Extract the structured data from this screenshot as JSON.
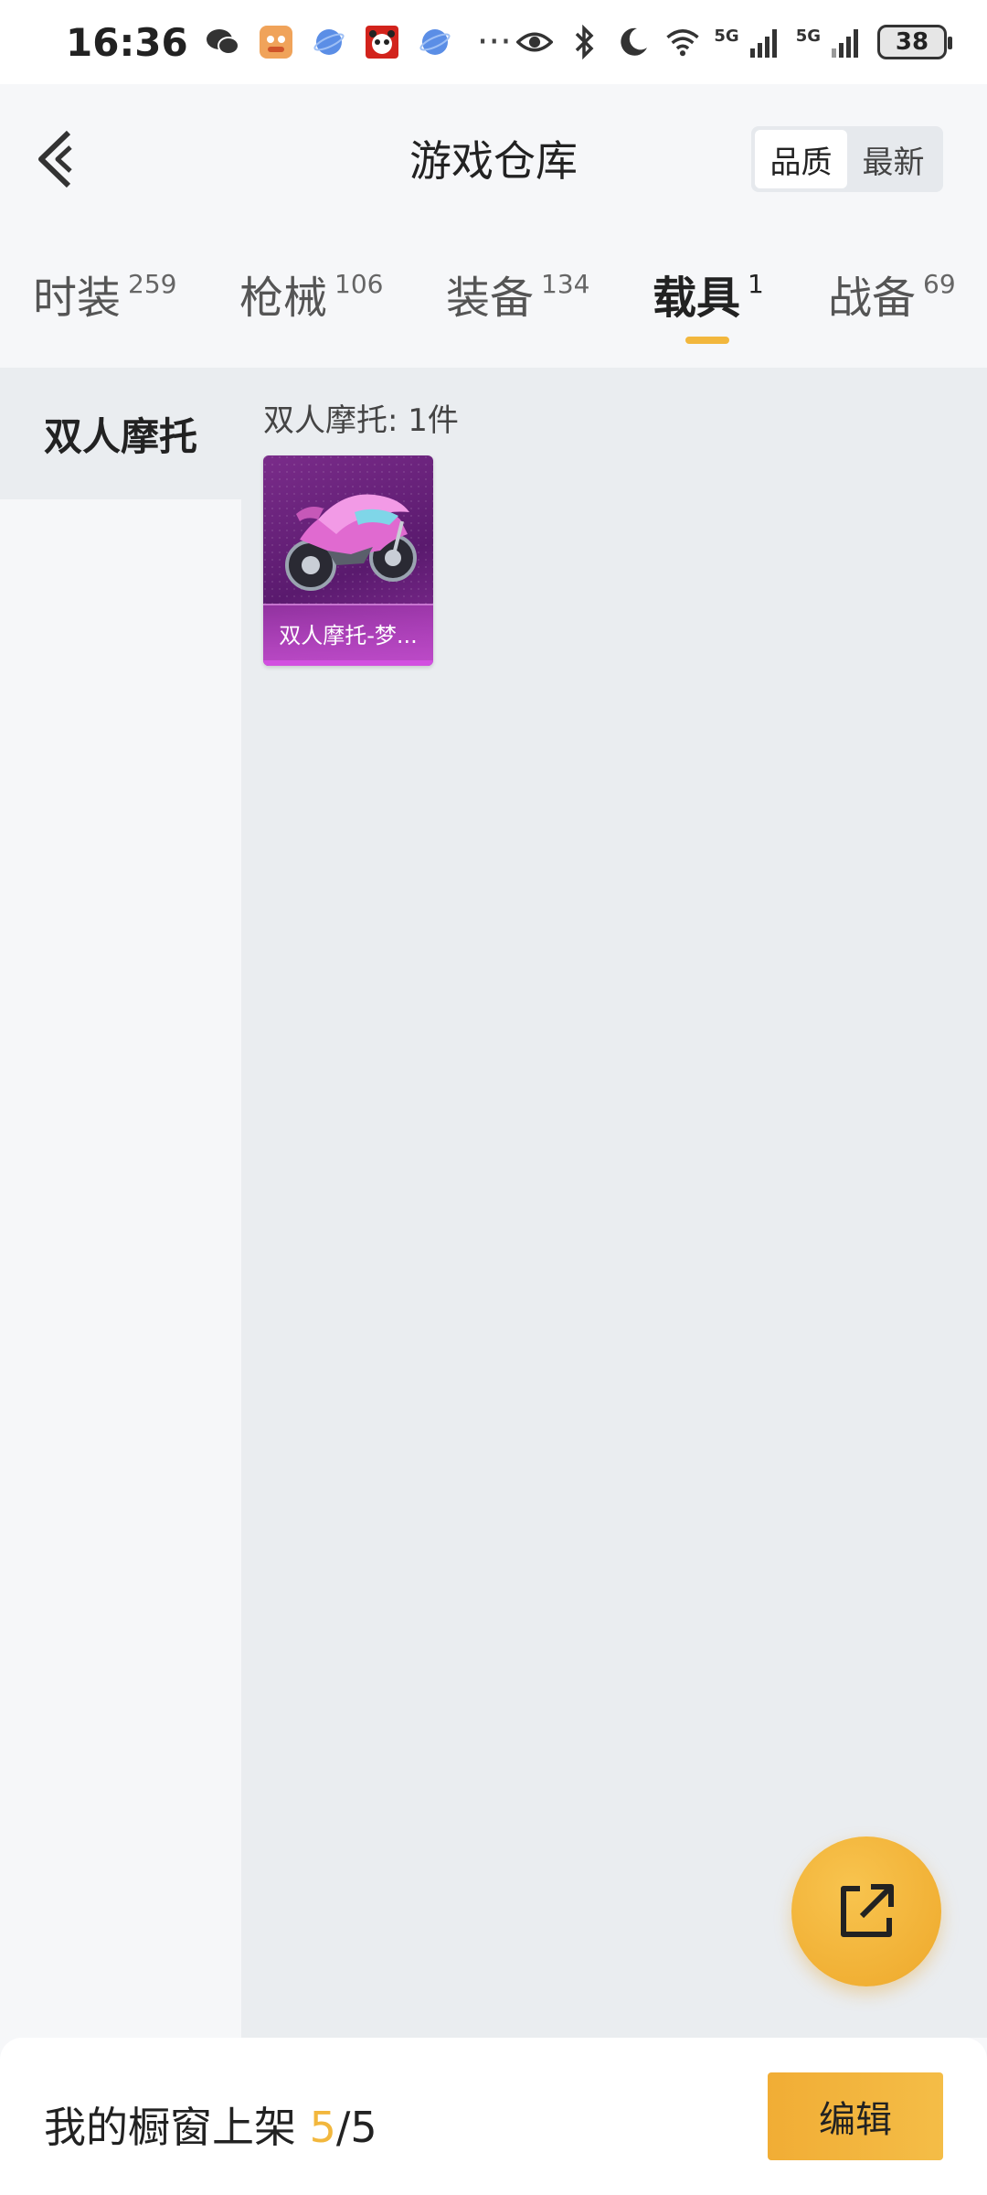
{
  "status_bar": {
    "time": "16:36",
    "battery": "38",
    "network_1": "5G",
    "network_2": "5G",
    "icons": [
      "wechat-icon",
      "app-icon",
      "browser-icon",
      "panda-app-icon",
      "browser-icon",
      "more-icon",
      "eye-icon",
      "bluetooth-icon",
      "moon-icon",
      "wifi-icon",
      "signal-icon",
      "signal-icon",
      "battery-icon"
    ]
  },
  "header": {
    "title": "游戏仓库",
    "sort_quality": "品质",
    "sort_newest": "最新"
  },
  "tabs": [
    {
      "label": "时装",
      "count": "259"
    },
    {
      "label": "枪械",
      "count": "106"
    },
    {
      "label": "装备",
      "count": "134"
    },
    {
      "label": "载具",
      "count": "1"
    },
    {
      "label": "战备",
      "count": "69"
    }
  ],
  "active_tab": "载具",
  "sidebar": {
    "items": [
      {
        "label": "双人摩托"
      }
    ]
  },
  "main": {
    "group_title": "双人摩托: 1件",
    "items": [
      {
        "name": "双人摩托-梦..."
      }
    ]
  },
  "bottom_bar": {
    "shelf_label": "我的橱窗上架 ",
    "shelf_current": "5",
    "shelf_total": "/5",
    "edit_label": "编辑"
  },
  "colors": {
    "accent": "#f2b73d",
    "item_purple": "#7a2c8a"
  }
}
